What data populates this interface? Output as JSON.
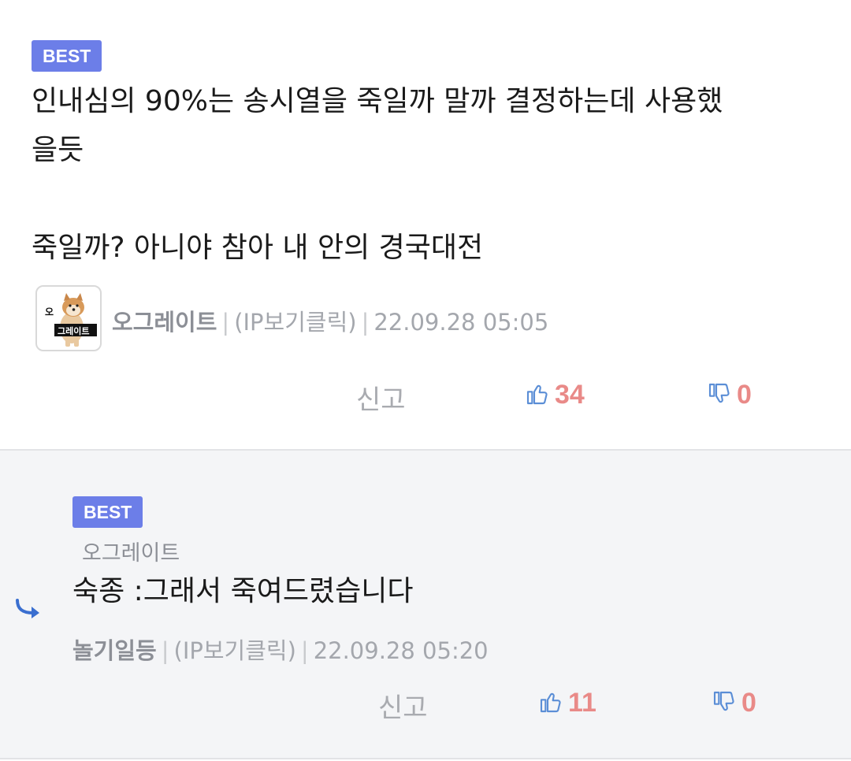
{
  "best_comment": {
    "badge": "BEST",
    "text_line1": "인내심의 90%는 송시열을 죽일까 말까 결정하는데 사용했",
    "text_line2": "을듯",
    "text_line3": "죽일까? 아니야 참아 내 안의 경국대전",
    "avatar_label_top": "오",
    "avatar_label_bottom": "그레이트",
    "author": "오그레이트",
    "ip_label": "(IP보기클릭)",
    "timestamp": "22.09.28 05:05",
    "report_label": "신고",
    "likes": "34",
    "dislikes": "0"
  },
  "best_reply": {
    "badge": "BEST",
    "reply_to": "오그레이트",
    "text": "숙종 :그래서 죽여드렸습니다",
    "author": "놀기일등",
    "ip_label": "(IP보기클릭)",
    "timestamp": "22.09.28 05:20",
    "report_label": "신고",
    "likes": "11",
    "dislikes": "0"
  },
  "colors": {
    "badge": "#6c7ee8",
    "count": "#e98a88",
    "thumb_icon": "#5b8ed6",
    "reply_bg": "#f4f5f7"
  },
  "icons": {
    "like": "thumbs-up-icon",
    "dislike": "thumbs-down-icon",
    "reply": "reply-arrow-icon"
  }
}
